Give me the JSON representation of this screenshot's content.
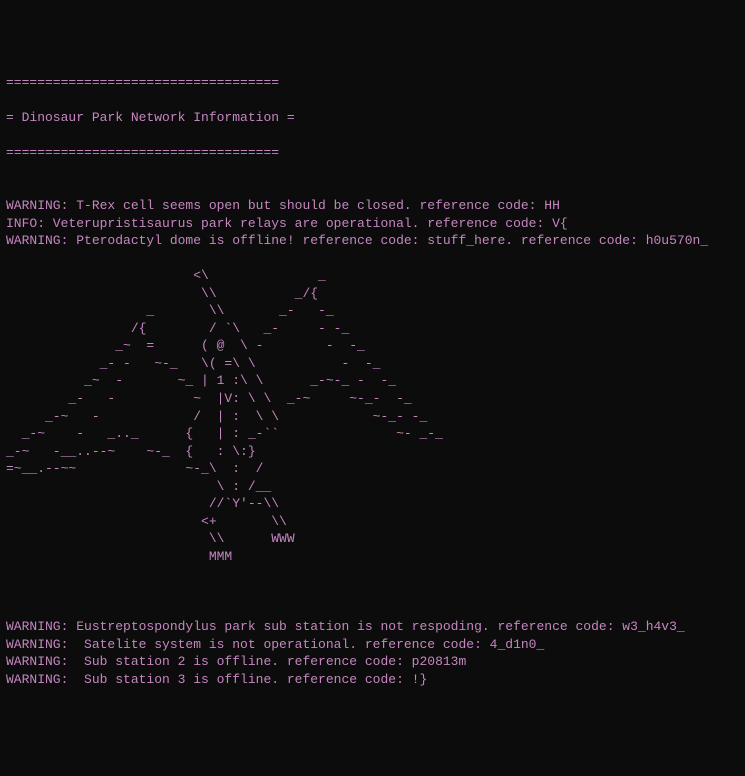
{
  "header": {
    "border": "===================================",
    "title": "= Dinosaur Park Network Information ="
  },
  "top_lines": [
    "",
    "WARNING: T-Rex cell seems open but should be closed. reference code: HH",
    "INFO: Veterupristisaurus park relays are operational. reference code: V{",
    "WARNING: Pterodactyl dome is offline! reference code: stuff_here. reference code: h0u570n_"
  ],
  "ascii": [
    "                        <\\              _",
    "                         \\\\          _/{",
    "                  _       \\\\       _-   -_",
    "                /{        / `\\   _-     - -_",
    "              _~  =      ( @  \\ -        -  -_",
    "            _- -   ~-_   \\( =\\ \\           -  -_",
    "          _~  -       ~_ | 1 :\\ \\      _-~-_ -  -_",
    "        _-   -          ~  |V: \\ \\  _-~     ~-_-  -_",
    "     _-~   -            /  | :  \\ \\            ~-_- -_",
    "  _-~    -   _.._      {   | : _-``               ~- _-_",
    "_-~   -__..--~    ~-_  {   : \\:}",
    "=~__.--~~              ~-_\\  :  /",
    "                           \\ : /__",
    "                          //`Y'--\\\\",
    "                         <+       \\\\",
    "                          \\\\      WWW",
    "                          MMM"
  ],
  "bottom_lines": [
    "",
    "",
    "WARNING: Eustreptospondylus park sub station is not respoding. reference code: w3_h4v3_",
    "WARNING:  Satelite system is not operational. reference code: 4_d1n0_",
    "WARNING:  Sub station 2 is offline. reference code: p20813m",
    "WARNING:  Sub station 3 is offline. reference code: !}"
  ]
}
